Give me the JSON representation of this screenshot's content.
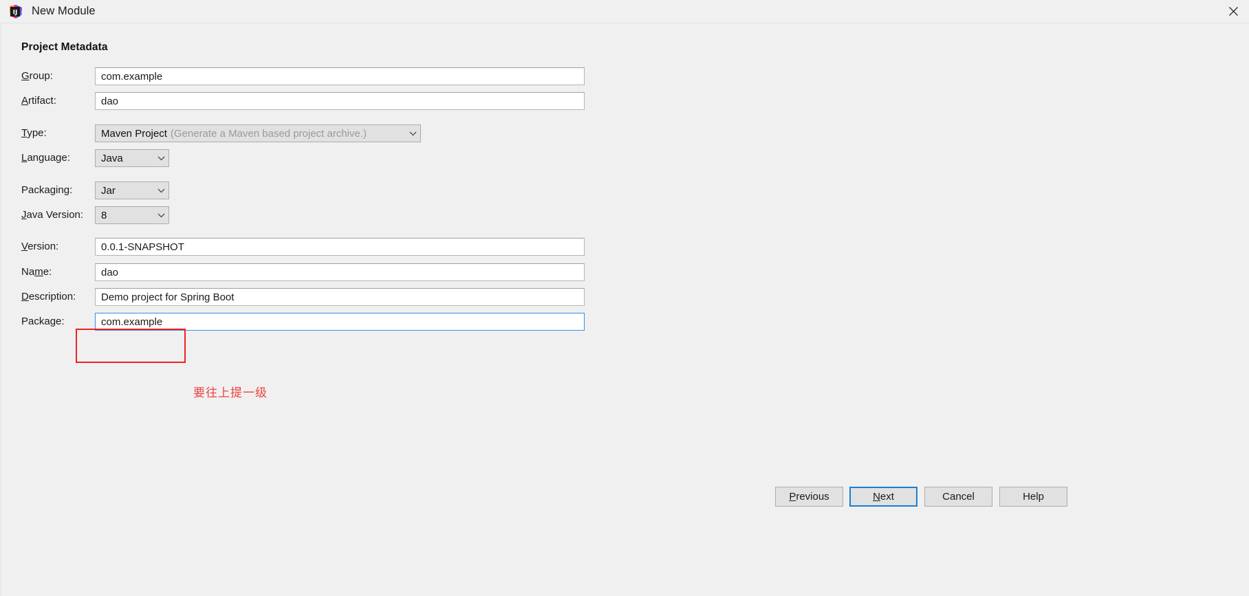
{
  "window": {
    "title": "New Module",
    "app_icon": "intellij-idea-icon",
    "close_icon": "close-icon"
  },
  "section": {
    "heading": "Project Metadata"
  },
  "fields": {
    "group": {
      "label_pre": "",
      "label_mnemonic": "G",
      "label_post": "roup:",
      "value": "com.example"
    },
    "artifact": {
      "label_pre": "",
      "label_mnemonic": "A",
      "label_post": "rtifact:",
      "value": "dao"
    },
    "type": {
      "label_pre": "",
      "label_mnemonic": "T",
      "label_post": "ype:",
      "value": "Maven Project",
      "hint": "(Generate a Maven based project archive.)"
    },
    "language": {
      "label_pre": "",
      "label_mnemonic": "L",
      "label_post": "anguage:",
      "value": "Java"
    },
    "packaging": {
      "label_pre": "Packa",
      "label_mnemonic": "g",
      "label_post": "ing:",
      "value": "Jar"
    },
    "java_version": {
      "label_pre": "",
      "label_mnemonic": "J",
      "label_post": "ava Version:",
      "value": "8"
    },
    "version": {
      "label_pre": "",
      "label_mnemonic": "V",
      "label_post": "ersion:",
      "value": "0.0.1-SNAPSHOT"
    },
    "name": {
      "label_pre": "Na",
      "label_mnemonic": "m",
      "label_post": "e:",
      "value": "dao"
    },
    "description": {
      "label_pre": "",
      "label_mnemonic": "D",
      "label_post": "escription:",
      "value": "Demo project for Spring Boot"
    },
    "package": {
      "label_pre": "Packa",
      "label_mnemonic": "g",
      "label_post": "e:",
      "value": "com.example"
    }
  },
  "annotation": {
    "note_text": "要往上提一级",
    "box_color": "#ee2222",
    "text_color": "#f04040"
  },
  "buttons": {
    "previous": {
      "pre": "",
      "mnemonic": "P",
      "post": "revious"
    },
    "next": {
      "pre": "",
      "mnemonic": "N",
      "post": "ext"
    },
    "cancel": {
      "pre": "Cancel",
      "mnemonic": "",
      "post": ""
    },
    "help": {
      "pre": "Help",
      "mnemonic": "",
      "post": ""
    }
  },
  "colors": {
    "focus_blue": "#3d8ae0",
    "default_button_blue": "#1a7fd4",
    "dialog_bg": "#f0f0f0",
    "control_bg": "#e1e1e1",
    "hint_gray": "#9a9a9a"
  }
}
